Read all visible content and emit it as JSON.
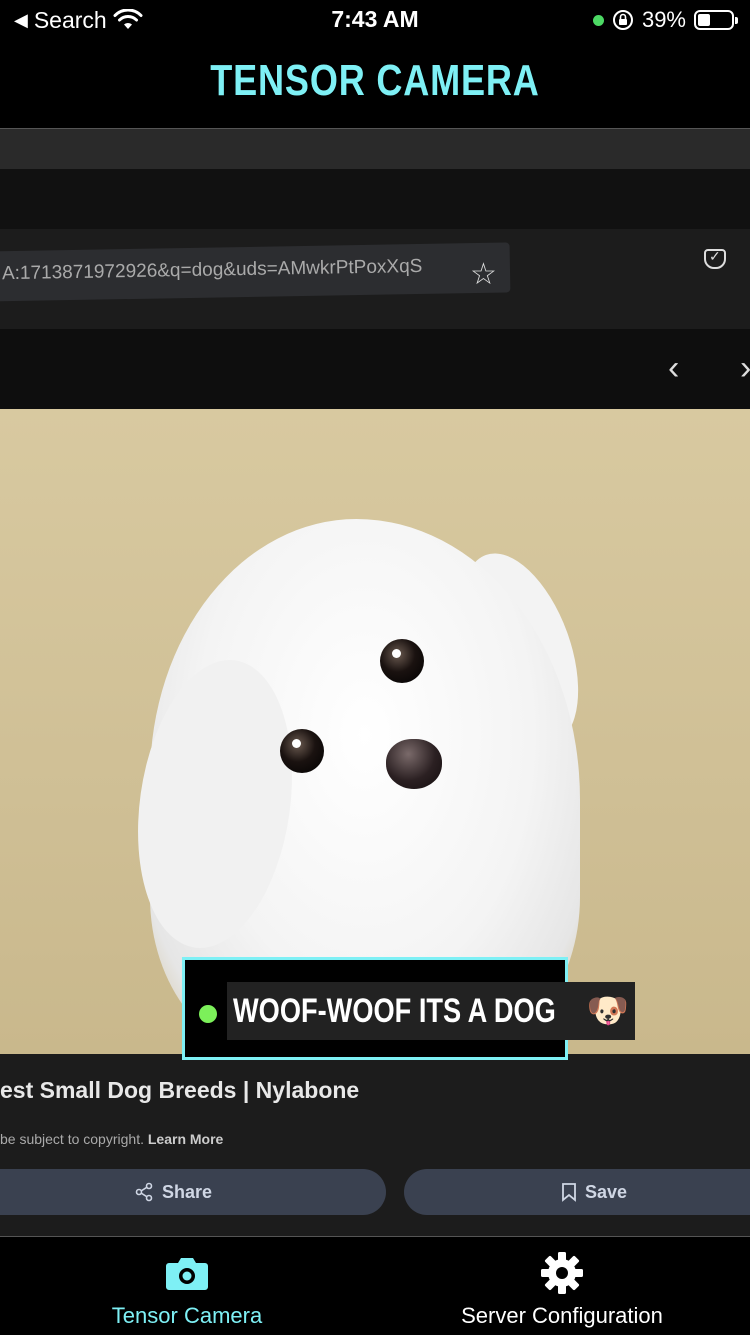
{
  "status_bar": {
    "back_label": "Search",
    "time": "7:43 AM",
    "battery_percent": "39%",
    "battery_level": 0.39
  },
  "header": {
    "title": "TENSOR CAMERA"
  },
  "camera_view": {
    "url_text": "A:1713871972926&q=dog&uds=AMwkrPtPoxXqS",
    "caption": "est Small Dog Breeds | Nylabone",
    "copyright_text": "be subject to copyright.",
    "learn_more": "Learn More",
    "share_label": "Share",
    "save_label": "Save"
  },
  "detection": {
    "label": "WOOF-WOOF ITS A DOG",
    "emoji": "🐶",
    "status_color": "#7cf05a",
    "box_color": "#7ef0f5"
  },
  "tabs": [
    {
      "label": "Tensor Camera",
      "icon": "camera-icon",
      "active": true
    },
    {
      "label": "Server Configuration",
      "icon": "gear-icon",
      "active": false
    }
  ],
  "colors": {
    "accent": "#7ef0f5",
    "background": "#000000"
  }
}
